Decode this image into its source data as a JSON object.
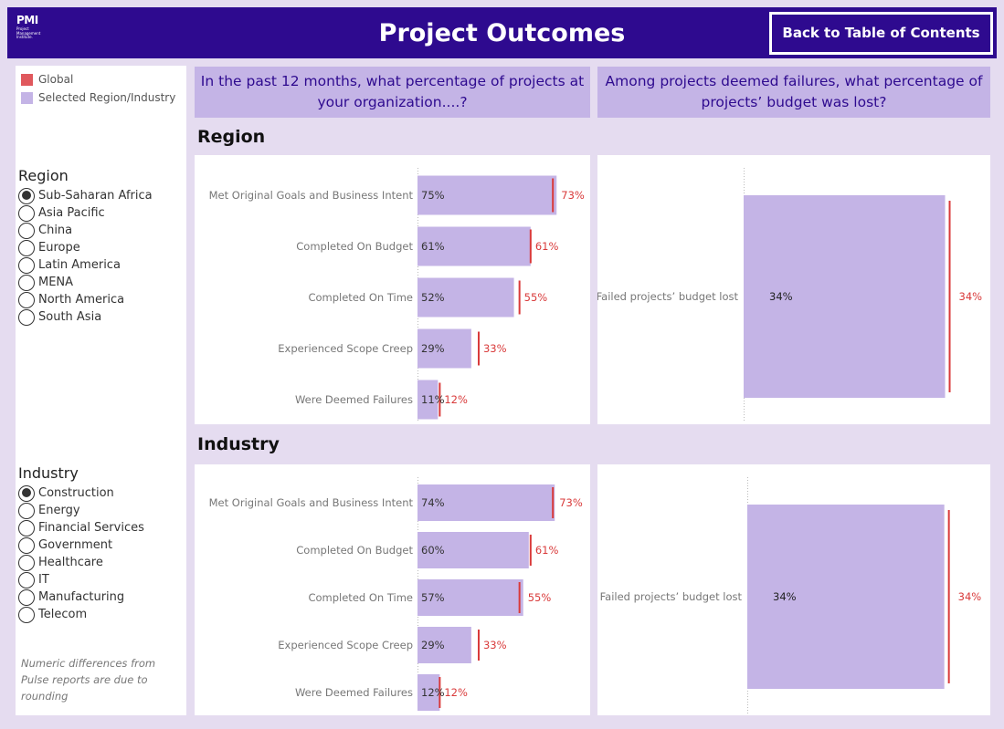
{
  "header": {
    "logo_text": "PMI",
    "logo_subtext": "Project Management Institute.",
    "title": "Project Outcomes",
    "toc_button": "Back to Table of Contents"
  },
  "legend": [
    {
      "label": "Global",
      "color": "#e0585d"
    },
    {
      "label": "Selected Region/Industry",
      "color": "#c4b4e6"
    }
  ],
  "colors": {
    "header": "#2e0a8f",
    "bar": "#c4b4e6",
    "global_marker": "#d93a3a",
    "background": "#e5dcf0"
  },
  "questions": {
    "left": "In the past 12 months, what percentage of projects at your organization....?",
    "right": "Among projects deemed failures, what percentage of projects’ budget was lost?"
  },
  "region_filter": {
    "title": "Region",
    "options": [
      "Sub-Saharan Africa",
      "Asia Pacific",
      "China",
      "Europe",
      "Latin America",
      "MENA",
      "North America",
      "South Asia"
    ],
    "selected": "Sub-Saharan Africa"
  },
  "industry_filter": {
    "title": "Industry",
    "options": [
      "Construction",
      "Energy",
      "Financial Services",
      "Government",
      "Healthcare",
      "IT",
      "Manufacturing",
      "Telecom"
    ],
    "selected": "Construction"
  },
  "sections": {
    "region": "Region",
    "industry": "Industry"
  },
  "footnote": "Numeric differences from Pulse reports are due to rounding",
  "chart_data": [
    {
      "id": "region-outcomes",
      "type": "bar",
      "orientation": "horizontal",
      "categories": [
        "Met Original Goals and Business Intent",
        "Completed On Budget",
        "Completed On Time",
        "Experienced Scope Creep",
        "Were Deemed Failures"
      ],
      "series": [
        {
          "name": "Selected Region/Industry",
          "values": [
            75,
            61,
            52,
            29,
            11
          ]
        },
        {
          "name": "Global",
          "values": [
            73,
            61,
            55,
            33,
            12
          ]
        }
      ],
      "value_labels": [
        "75%",
        "61%",
        "52%",
        "29%",
        "11%"
      ],
      "global_labels": [
        "73%",
        "61%",
        "55%",
        "33%",
        "12%"
      ],
      "xlim": [
        0,
        100
      ]
    },
    {
      "id": "region-budget",
      "type": "bar",
      "orientation": "horizontal",
      "categories": [
        "Failed projects’ budget lost"
      ],
      "series": [
        {
          "name": "Selected Region/Industry",
          "values": [
            34
          ]
        },
        {
          "name": "Global",
          "values": [
            34
          ]
        }
      ],
      "value_labels": [
        "34%"
      ],
      "global_labels": [
        "34%"
      ],
      "xlim": [
        0,
        35
      ]
    },
    {
      "id": "industry-outcomes",
      "type": "bar",
      "orientation": "horizontal",
      "categories": [
        "Met Original Goals and Business Intent",
        "Completed On Budget",
        "Completed On Time",
        "Experienced Scope Creep",
        "Were Deemed Failures"
      ],
      "series": [
        {
          "name": "Selected Region/Industry",
          "values": [
            74,
            60,
            57,
            29,
            12
          ]
        },
        {
          "name": "Global",
          "values": [
            73,
            61,
            55,
            33,
            12
          ]
        }
      ],
      "value_labels": [
        "74%",
        "60%",
        "57%",
        "29%",
        "12%"
      ],
      "global_labels": [
        "73%",
        "61%",
        "55%",
        "33%",
        "12%"
      ],
      "xlim": [
        0,
        100
      ]
    },
    {
      "id": "industry-budget",
      "type": "bar",
      "orientation": "horizontal",
      "categories": [
        "Failed projects’ budget lost"
      ],
      "series": [
        {
          "name": "Selected Region/Industry",
          "values": [
            34
          ]
        },
        {
          "name": "Global",
          "values": [
            34
          ]
        }
      ],
      "value_labels": [
        "34%"
      ],
      "global_labels": [
        "34%"
      ],
      "xlim": [
        0,
        35
      ]
    }
  ]
}
